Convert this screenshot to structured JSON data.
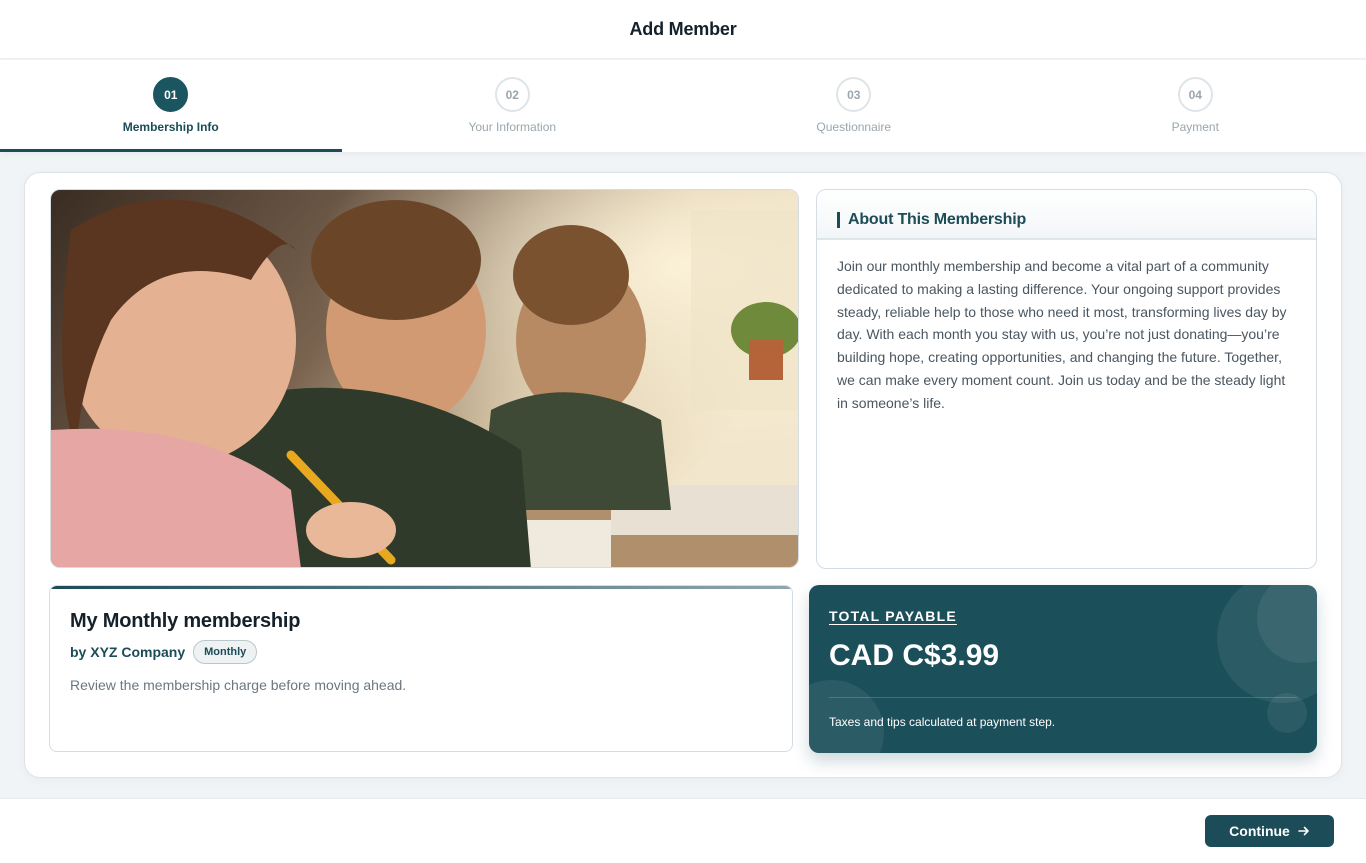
{
  "header": {
    "title": "Add Member"
  },
  "steps": [
    {
      "number": "01",
      "label": "Membership Info",
      "active": true
    },
    {
      "number": "02",
      "label": "Your Information",
      "active": false
    },
    {
      "number": "03",
      "label": "Questionnaire",
      "active": false
    },
    {
      "number": "04",
      "label": "Payment",
      "active": false
    }
  ],
  "about": {
    "title": "About This Membership",
    "body": "Join our monthly membership and become a vital part of a community dedicated to making a lasting difference. Your ongoing support provides steady, reliable help to those who need it most, transforming lives day by day. With each month you stay with us, you’re not just donating—you’re building hope, creating opportunities, and changing the future. Together, we can make every moment count. Join us today and be the steady light in someone’s life."
  },
  "membership": {
    "name": "My Monthly membership",
    "company": "by XYZ Company",
    "frequency": "Monthly",
    "description": "Review the membership charge before moving ahead."
  },
  "total": {
    "label": "TOTAL PAYABLE",
    "amount": "CAD C$3.99",
    "note": "Taxes and tips calculated at payment step."
  },
  "footer": {
    "continue_label": "Continue"
  },
  "colors": {
    "primary": "#1b4c57",
    "total_bg": "#1b4f5a",
    "muted": "#9aa6ae"
  }
}
